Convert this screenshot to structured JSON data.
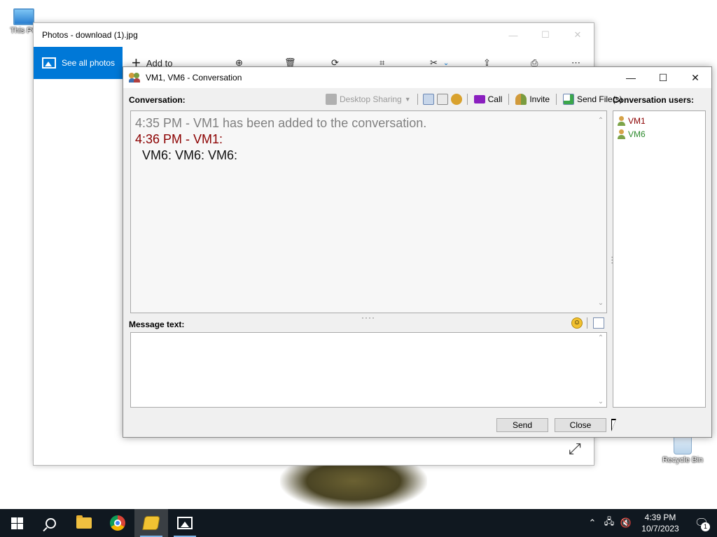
{
  "desktop": {
    "icons": [
      {
        "label": "This PC"
      },
      {
        "label": "Recycle Bin"
      }
    ]
  },
  "photos": {
    "title": "Photos - download (1).jpg",
    "see_all": "See all photos",
    "add_to": "Add to",
    "accent": "#0078d7"
  },
  "conversation": {
    "title": "VM1, VM6 - Conversation",
    "conversation_label": "Conversation:",
    "users_label": "Conversation users:",
    "message_label": "Message text:",
    "toolbar": {
      "desktop_sharing": "Desktop Sharing",
      "call": "Call",
      "invite": "Invite",
      "send_files": "Send File(s)"
    },
    "messages": {
      "system": "4:35 PM - VM1 has been added to the conversation.",
      "header": "4:36 PM - VM1:",
      "body": "VM6: VM6: VM6:"
    },
    "users": [
      {
        "name": "VM1",
        "color": "#8b0000"
      },
      {
        "name": "VM6",
        "color": "#2e8b2e"
      }
    ],
    "message_text_value": "",
    "send_label": "Send",
    "close_label": "Close"
  },
  "taskbar": {
    "time": "4:39 PM",
    "date": "10/7/2023",
    "notification_count": "1",
    "bg": "#101820"
  }
}
